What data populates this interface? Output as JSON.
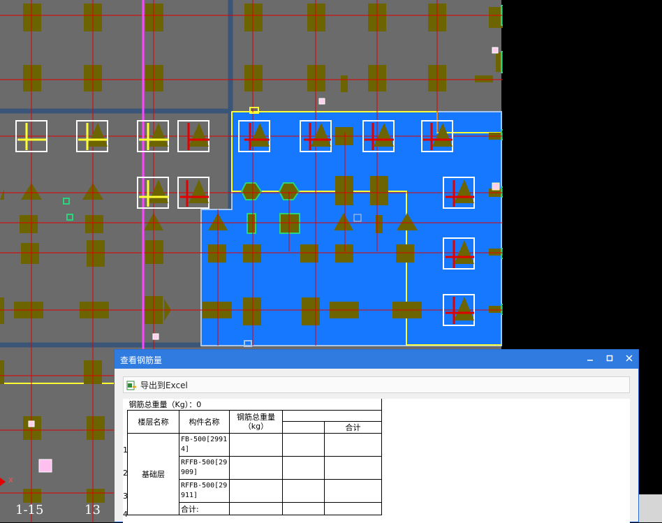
{
  "colors": {
    "background": "#6b6b6b",
    "active_region": "#1677ff",
    "column_fill": "#6b6400",
    "grid_line": "#e10000",
    "beam_line": "#3a5577",
    "highlight": "#ffff33",
    "magenta_line": "#ff44ff",
    "titlebar": "#2f7be0"
  },
  "axis_labels": [
    "1-15",
    "13"
  ],
  "axis_marker": "X",
  "dialog": {
    "title": "查看钢筋量",
    "minimize_icon": "minimize-icon",
    "maximize_icon": "maximize-icon",
    "close_icon": "close-icon",
    "export_label": "导出到Excel",
    "table": {
      "total_label": "钢筋总重量（Kg）：0",
      "headers": {
        "floor": "楼层名称",
        "component": "构件名称",
        "total_weight": "钢筋总重量（kg）",
        "sum": "合计"
      },
      "floor_name": "基础层",
      "rows": [
        {
          "num": "1",
          "component": "FB-500[29914]"
        },
        {
          "num": "2",
          "component": "RFFB-500[29909]"
        },
        {
          "num": "3",
          "component": "RFFB-500[29911]"
        },
        {
          "num": "4",
          "component": "合计:"
        }
      ]
    }
  }
}
